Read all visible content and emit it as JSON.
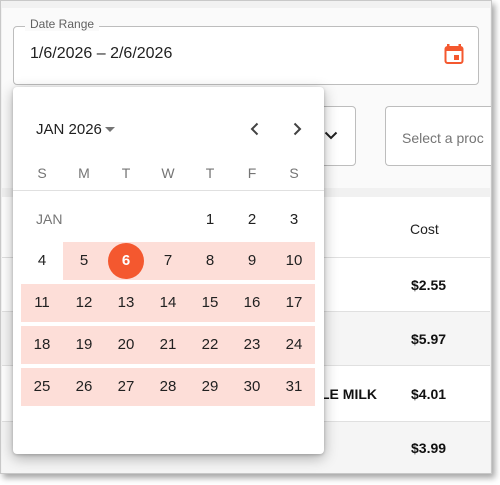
{
  "date_range": {
    "legend": "Date Range",
    "value": "1/6/2026 – 2/6/2026",
    "icon": "calendar-icon",
    "accent": "#f4582f"
  },
  "filters": {
    "dropdown_icon": "chevron-down-icon",
    "product_placeholder": "Select a proc"
  },
  "table": {
    "cost_header": "Cost",
    "costs": [
      "$2.55",
      "$5.97",
      "$4.01",
      "$3.99"
    ],
    "partial_cell": "LE MILK"
  },
  "calendar": {
    "month_label": "JAN 2026",
    "weekdays": [
      "S",
      "M",
      "T",
      "W",
      "T",
      "F",
      "S"
    ],
    "month_short": "JAN",
    "selected_day": "6",
    "range_color": "#fdded8",
    "selected_color": "#f4582f",
    "weeks": [
      [
        "",
        "",
        "",
        "",
        "1",
        "2",
        "3"
      ],
      [
        "4",
        "5",
        "6",
        "7",
        "8",
        "9",
        "10"
      ],
      [
        "11",
        "12",
        "13",
        "14",
        "15",
        "16",
        "17"
      ],
      [
        "18",
        "19",
        "20",
        "21",
        "22",
        "23",
        "24"
      ],
      [
        "25",
        "26",
        "27",
        "28",
        "29",
        "30",
        "31"
      ]
    ]
  }
}
